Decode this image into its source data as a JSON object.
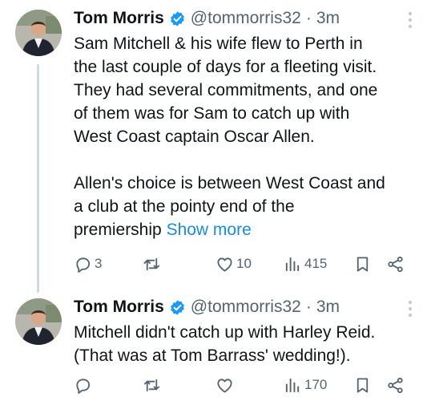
{
  "colors": {
    "text": "#0f1419",
    "muted": "#536471",
    "link": "#1a8cd8",
    "verified": "#1d9bf0",
    "thread_line": "#cfd9de"
  },
  "tweets": [
    {
      "name": "Tom Morris",
      "handle": "@tommorris32",
      "separator": "·",
      "time": "3m",
      "lines": [
        "Sam Mitchell & his wife flew to Perth in",
        "the last couple of days for a fleeting visit.",
        "They had several commitments, and one",
        "of them was for Sam to catch up with",
        "West Coast captain Oscar Allen."
      ],
      "lines2": [
        "Allen's choice is between West Coast and",
        "a club at the pointy end of the",
        "premiership"
      ],
      "show_more": "Show more",
      "replies": "3",
      "likes": "10",
      "views": "415"
    },
    {
      "name": "Tom Morris",
      "handle": "@tommorris32",
      "separator": "·",
      "time": "3m",
      "lines": [
        "Mitchell didn't catch up with Harley Reid.",
        "(That was at Tom Barrass' wedding!)."
      ],
      "views": "170"
    }
  ]
}
